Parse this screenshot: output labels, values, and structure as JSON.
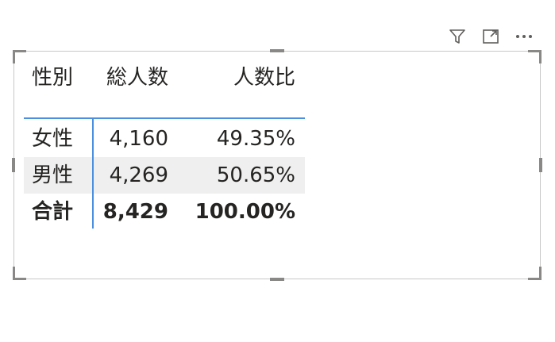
{
  "visual_header": {
    "icons": [
      "filter-icon",
      "focus-mode-icon",
      "more-options-icon"
    ]
  },
  "table": {
    "columns": [
      "性別",
      "総人数",
      "人数比"
    ],
    "rows": [
      {
        "gender": "女性",
        "count": "4,160",
        "ratio": "49.35%"
      },
      {
        "gender": "男性",
        "count": "4,269",
        "ratio": "50.65%"
      }
    ],
    "total": {
      "gender": "合計",
      "count": "8,429",
      "ratio": "100.00%"
    }
  },
  "colors": {
    "accent": "#4a8fe0",
    "alt_row": "#efefef",
    "frame": "#c8c8c8",
    "text": "#252423"
  }
}
